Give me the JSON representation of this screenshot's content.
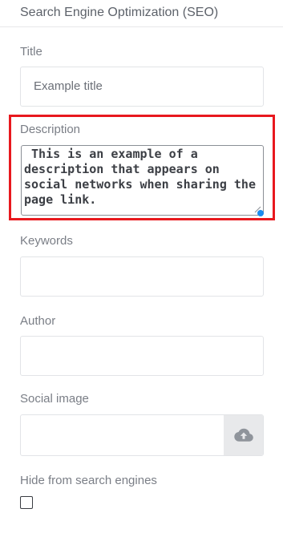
{
  "panel": {
    "title": "Search Engine Optimization (SEO)"
  },
  "fields": {
    "title": {
      "label": "Title",
      "value": "Example title"
    },
    "description": {
      "label": "Description",
      "value": " This is an example of a description that appears on social networks when sharing the page link."
    },
    "keywords": {
      "label": "Keywords",
      "value": ""
    },
    "author": {
      "label": "Author",
      "value": ""
    },
    "social_image": {
      "label": "Social image",
      "upload_icon": "cloud-upload-icon"
    },
    "hide_from_search": {
      "label": "Hide from search engines",
      "checked": false
    }
  },
  "colors": {
    "highlight": "#e8181e",
    "focus_dot": "#1a8cf0",
    "upload_button_bg": "#e8e9eb"
  }
}
